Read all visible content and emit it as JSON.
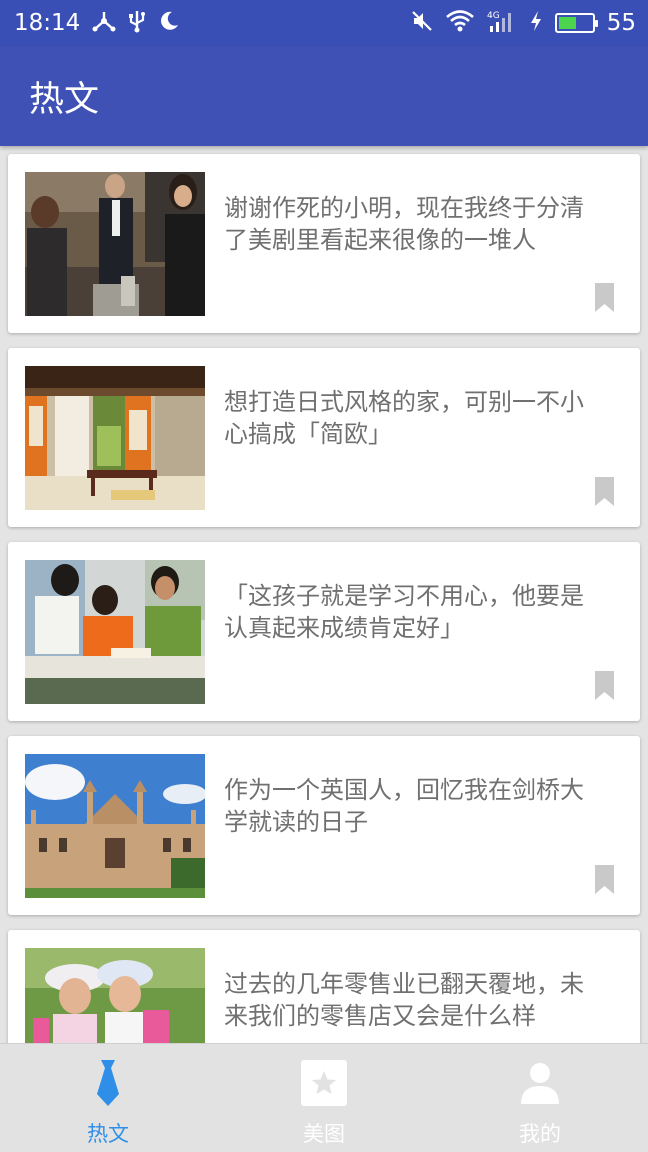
{
  "status_bar": {
    "time": "18:14",
    "battery_percent": "55",
    "battery_level": 0.55,
    "icons": [
      "usb-share-icon",
      "usb-icon",
      "moon-icon",
      "mute-icon",
      "wifi-icon",
      "signal-4g-icon",
      "charging-icon",
      "battery-icon"
    ]
  },
  "app_bar": {
    "title": "热文"
  },
  "articles": [
    {
      "title": "谢谢作死的小明，现在我终于分清了美剧里看起来很像的一堆人"
    },
    {
      "title": "想打造日式风格的家，可别一不小心搞成「简欧」"
    },
    {
      "title": "「这孩子就是学习不用心，他要是认真起来成绩肯定好」"
    },
    {
      "title": "作为一个英国人，回忆我在剑桥大学就读的日子"
    },
    {
      "title": "过去的几年零售业已翻天覆地，未来我们的零售店又会是什么样"
    }
  ],
  "bottom_nav": {
    "items": [
      {
        "label": "热文",
        "icon": "tie-icon",
        "active": true
      },
      {
        "label": "美图",
        "icon": "star-icon",
        "active": false
      },
      {
        "label": "我的",
        "icon": "person-icon",
        "active": false
      }
    ]
  },
  "colors": {
    "primary": "#3f51b5",
    "status_bar": "#3a4fb6",
    "active_tab": "#2f8fe8"
  }
}
